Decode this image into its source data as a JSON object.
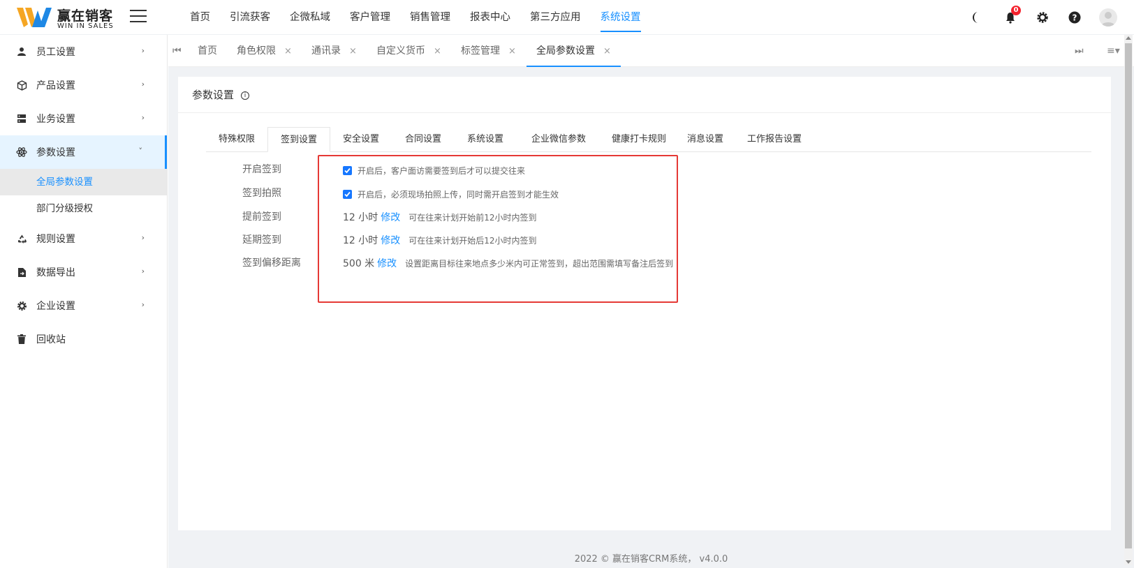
{
  "app": {
    "logo_cn": "赢在销客",
    "logo_en": "WIN IN SALES"
  },
  "topnav": [
    "首页",
    "引流获客",
    "企微私域",
    "客户管理",
    "销售管理",
    "报表中心",
    "第三方应用",
    "系统设置"
  ],
  "topnav_active": "系统设置",
  "notification_count": "0",
  "sidebar": {
    "items": [
      {
        "label": "员工设置",
        "icon": "user-icon"
      },
      {
        "label": "产品设置",
        "icon": "cube-icon"
      },
      {
        "label": "业务设置",
        "icon": "server-icon"
      },
      {
        "label": "参数设置",
        "icon": "atom-icon"
      },
      {
        "label": "规则设置",
        "icon": "recycle-icon"
      },
      {
        "label": "数据导出",
        "icon": "file-export-icon"
      },
      {
        "label": "企业设置",
        "icon": "gear-icon"
      },
      {
        "label": "回收站",
        "icon": "trash-icon"
      }
    ],
    "subitems": [
      "全局参数设置",
      "部门分级授权"
    ]
  },
  "tabs": [
    "首页",
    "角色权限",
    "通讯录",
    "自定义货币",
    "标签管理",
    "全局参数设置"
  ],
  "tabs_active": "全局参数设置",
  "page_title": "参数设置",
  "subtabs": [
    "特殊权限",
    "签到设置",
    "安全设置",
    "合同设置",
    "系统设置",
    "企业微信参数",
    "健康打卡规则",
    "消息设置",
    "工作报告设置"
  ],
  "subtabs_active": "签到设置",
  "settings": [
    {
      "label": "开启签到",
      "checked": true,
      "desc": "开启后，客户面访需要签到后才可以提交往来"
    },
    {
      "label": "签到拍照",
      "checked": true,
      "desc": "开启后，必须现场拍照上传，同时需开启签到才能生效"
    },
    {
      "label": "提前签到",
      "value": "12 小时",
      "link": "修改",
      "desc": "可在往来计划开始前12小时内签到"
    },
    {
      "label": "延期签到",
      "value": "12 小时",
      "link": "修改",
      "desc": "可在往来计划开始后12小时内签到"
    },
    {
      "label": "签到偏移距离",
      "value": "500 米",
      "link": "修改",
      "desc": "设置距离目标往来地点多少米内可正常签到，超出范围需填写备注后签到"
    }
  ],
  "footer": "2022 © 赢在销客CRM系统， v4.0.0",
  "colors": {
    "accent": "#1890ff",
    "highlight_box": "#e53935",
    "badge": "#f5222d"
  }
}
